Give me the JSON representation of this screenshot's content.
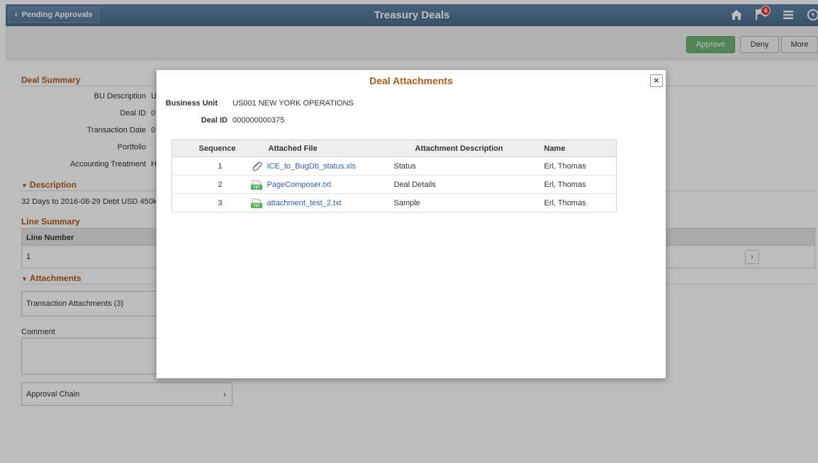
{
  "banner": {
    "back_label": "Pending Approvals",
    "title": "Treasury Deals",
    "notification_count": "4",
    "icons": [
      "home-icon",
      "flag-icon",
      "menu-icon",
      "compass-icon"
    ]
  },
  "toolbar": {
    "approve_label": "Approve",
    "deny_label": "Deny",
    "more_label": "More"
  },
  "deal_summary": {
    "heading": "Deal Summary",
    "fields": [
      {
        "label": "BU Description",
        "value": "U"
      },
      {
        "label": "Deal ID",
        "value": "0"
      },
      {
        "label": "Transaction Date",
        "value": "0"
      },
      {
        "label": "Portfolio",
        "value": ""
      },
      {
        "label": "Accounting Treatment",
        "value": "H"
      }
    ]
  },
  "description": {
    "heading": "Description",
    "text": "32 Days to 2016-08-29 Debt USD 450k"
  },
  "line_summary": {
    "heading": "Line Summary",
    "column": "Line Number",
    "rows": [
      "1"
    ]
  },
  "attachments_section": {
    "heading": "Attachments",
    "link_label": "Transaction Attachments (3)"
  },
  "comment": {
    "label": "Comment"
  },
  "approval_chain": {
    "label": "Approval Chain"
  },
  "modal": {
    "title": "Deal Attachments",
    "business_unit_label": "Business Unit",
    "business_unit_value": "US001 NEW YORK OPERATIONS",
    "deal_id_label": "Deal ID",
    "deal_id_value": "000000000375",
    "columns": [
      "Sequence",
      "Attached File",
      "Attachment Description",
      "Name"
    ],
    "rows": [
      {
        "sequence": "1",
        "file": "ICE_to_BugDb_status.xls",
        "icon": "paperclip-icon",
        "description": "Status",
        "name": "Erl, Thomas"
      },
      {
        "sequence": "2",
        "file": "PageComposer.txt",
        "icon": "text-file-icon",
        "description": "Deal Details",
        "name": "Erl, Thomas"
      },
      {
        "sequence": "3",
        "file": "attachment_test_2.txt",
        "icon": "text-file-icon",
        "description": "Sample",
        "name": "Erl, Thomas"
      }
    ]
  },
  "colors": {
    "banner": "#5f83a5",
    "section_heading": "#b05a1a",
    "approve": "#6fb375",
    "link": "#2f5fb8"
  }
}
